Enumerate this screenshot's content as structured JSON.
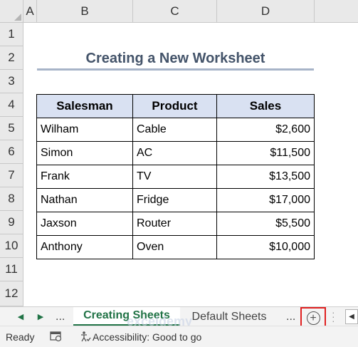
{
  "columns": [
    "A",
    "B",
    "C",
    "D"
  ],
  "rows": [
    "1",
    "2",
    "3",
    "4",
    "5",
    "6",
    "7",
    "8",
    "9",
    "10",
    "11",
    "12"
  ],
  "title": "Creating a New Worksheet",
  "table": {
    "headers": [
      "Salesman",
      "Product",
      "Sales"
    ],
    "rows": [
      [
        "Wilham",
        "Cable",
        "$2,600"
      ],
      [
        "Simon",
        "AC",
        "$11,500"
      ],
      [
        "Frank",
        "TV",
        "$13,500"
      ],
      [
        "Nathan",
        "Fridge",
        "$17,000"
      ],
      [
        "Jaxson",
        "Router",
        "$5,500"
      ],
      [
        "Anthony",
        "Oven",
        "$10,000"
      ]
    ]
  },
  "tabs": {
    "ellipsis": "...",
    "active": "Creating Sheets",
    "other": "Default Sheets",
    "add_icon": "plus-circle-icon"
  },
  "watermark": "exceldemy",
  "status": {
    "ready": "Ready",
    "accessibility": "Accessibility: Good to go"
  },
  "colors": {
    "accent": "#217346",
    "header_fill": "#d9e1f2",
    "title": "#44546a",
    "highlight": "#e02020"
  }
}
